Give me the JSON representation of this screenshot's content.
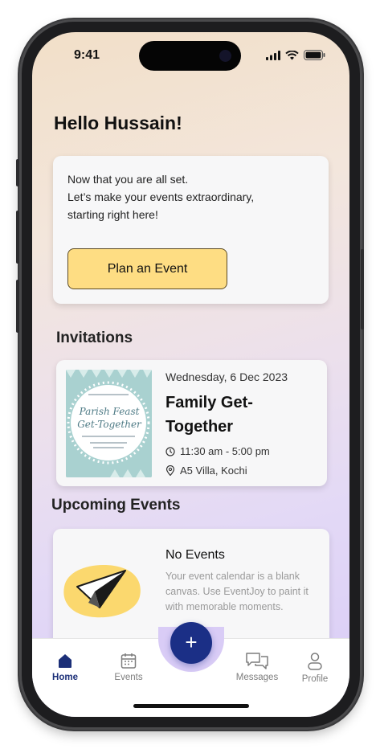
{
  "status_bar": {
    "time": "9:41"
  },
  "greeting": "Hello Hussain!",
  "welcome_card": {
    "lines": [
      "Now that you are all set.",
      "Let’s make your events extraordinary,",
      "starting right here!"
    ],
    "button_label": "Plan an Event"
  },
  "invitations": {
    "heading": "Invitations",
    "item": {
      "date": "Wednesday, 6 Dec 2023",
      "title": "Family Get-Together",
      "time": "11:30 am - 5:00 pm",
      "location": "A5 Villa, Kochi",
      "thumb_text": "Parish Feast Get-Together"
    }
  },
  "upcoming": {
    "heading": "Upcoming Events",
    "empty_title": "No Events",
    "empty_desc": "Your event calendar is a blank canvas. Use EventJoy to paint it with memorable moments."
  },
  "nav": {
    "items": [
      {
        "label": "Home",
        "icon": "home-icon",
        "active": true
      },
      {
        "label": "Events",
        "icon": "calendar-icon",
        "active": false
      },
      {
        "label": "Messages",
        "icon": "messages-icon",
        "active": false
      },
      {
        "label": "Profile",
        "icon": "profile-icon",
        "active": false
      }
    ],
    "add_icon": "plus-icon"
  },
  "colors": {
    "accent": "#1b2f86",
    "button_yellow": "#fedd83",
    "blob_yellow": "#fbd86e"
  }
}
